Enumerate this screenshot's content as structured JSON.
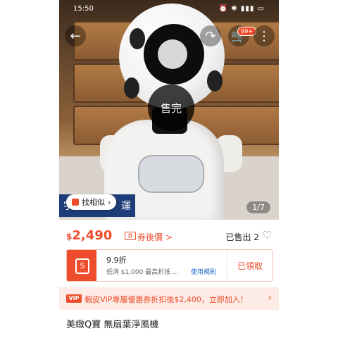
{
  "status_bar": {
    "time": "15:50",
    "right": "⏰ ✱ ▮▮▮ ▭"
  },
  "photo": {
    "sold_overlay": "售完",
    "image_counter": "1/7",
    "banner_left": "宇",
    "banner_right": "運"
  },
  "topbar": {
    "cart_badge": "99+"
  },
  "find_similar": {
    "label": "找相似",
    "chevron": "›"
  },
  "price": {
    "currency": "$",
    "amount": "2,490",
    "coupon_tag": "券",
    "after_coupon": "券後價 >",
    "sold": "已售出 2"
  },
  "voucher": {
    "icon": "S",
    "discount": "9.9折",
    "desc": "低消 $1,000 最高折抵 ...",
    "rules": "使用規則",
    "claimed": "已領取"
  },
  "vip": {
    "icon": "VIP",
    "text": "蝦皮VIP專屬優惠券折扣後$2,400，立即加入！",
    "chevron": "›"
  },
  "product_title": "美緻Q寶 無扇葉淨風機",
  "colors": {
    "accent": "#ee4d2d",
    "link": "#1a64c8"
  }
}
